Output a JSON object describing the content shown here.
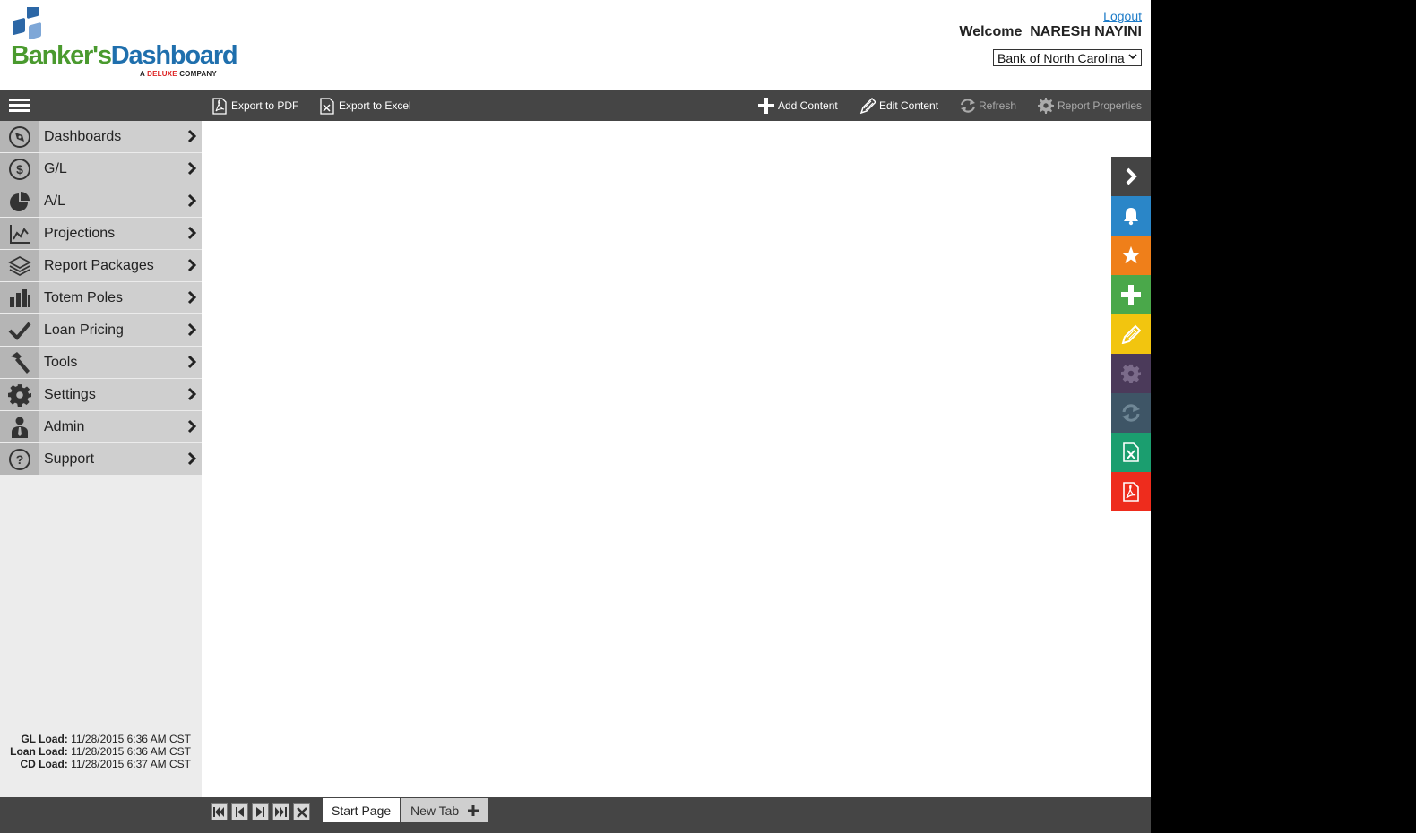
{
  "header": {
    "logo": {
      "part1": "Banker's",
      "part2": "Dashboard",
      "tagline_prefix": "A ",
      "tagline_brand": "DELUXE",
      "tagline_suffix": " COMPANY"
    },
    "logout": "Logout",
    "welcome": "Welcome  NARESH NAYINI",
    "bank_selected": "Bank of North Carolina"
  },
  "toolbar": {
    "export_pdf": "Export to PDF",
    "export_excel": "Export to Excel",
    "add_content": "Add Content",
    "edit_content": "Edit Content",
    "refresh": "Refresh",
    "report_properties": "Report Properties"
  },
  "sidebar": {
    "items": [
      {
        "label": "Dashboards",
        "icon": "compass-icon"
      },
      {
        "label": "G/L",
        "icon": "dollar-circle-icon"
      },
      {
        "label": "A/L",
        "icon": "pie-chart-icon"
      },
      {
        "label": "Projections",
        "icon": "line-chart-icon"
      },
      {
        "label": "Report Packages",
        "icon": "layers-icon"
      },
      {
        "label": "Totem Poles",
        "icon": "bar-chart-icon"
      },
      {
        "label": "Loan Pricing",
        "icon": "checkmark-icon"
      },
      {
        "label": "Tools",
        "icon": "hammer-icon"
      },
      {
        "label": "Settings",
        "icon": "gear-icon"
      },
      {
        "label": "Admin",
        "icon": "user-tie-icon"
      },
      {
        "label": "Support",
        "icon": "question-circle-icon"
      }
    ],
    "loads": {
      "gl_label": "GL Load:",
      "gl_value": "11/28/2015 6:36 AM CST",
      "loan_label": "Loan Load:",
      "loan_value": "11/28/2015 6:36 AM CST",
      "cd_label": "CD Load:",
      "cd_value": "11/28/2015 6:37 AM CST"
    }
  },
  "rail": {
    "buttons": [
      {
        "icon": "chevron-right-icon",
        "color": "#444444"
      },
      {
        "icon": "bell-icon",
        "color": "#2a86c8"
      },
      {
        "icon": "star-icon",
        "color": "#ef7f1a"
      },
      {
        "icon": "plus-icon",
        "color": "#4aa84a"
      },
      {
        "icon": "pen-icon",
        "color": "#f2c50f"
      },
      {
        "icon": "gear-icon",
        "color": "#4b3a5a"
      },
      {
        "icon": "refresh-icon",
        "color": "#3e5566"
      },
      {
        "icon": "excel-icon",
        "color": "#1b9e6f"
      },
      {
        "icon": "pdf-icon",
        "color": "#ee2c1d"
      }
    ]
  },
  "tabs": {
    "start_page": "Start Page",
    "new_tab": "New Tab"
  }
}
